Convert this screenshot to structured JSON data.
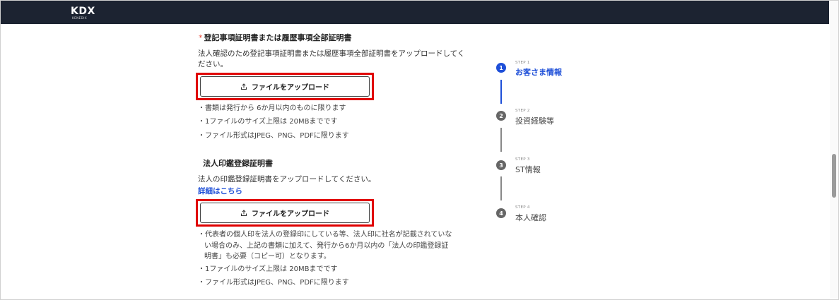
{
  "header": {
    "logo": "KDX",
    "logo_sub": "KENEDIX"
  },
  "section1": {
    "required_mark": "*",
    "title": "登記事項証明書または履歴事項全部証明書",
    "desc_line1": "法人確認のため登記事項証明書または履歴事項全部証明書をアップロードしてく",
    "desc_line2": "ださい。",
    "upload_label": "ファイルをアップロード",
    "bullets": [
      "・書類は発行から 6か月以内のものに限ります",
      "・1ファイルのサイズ上限は 20MBまでです",
      "・ファイル形式はJPEG、PNG、PDFに限ります"
    ]
  },
  "section2": {
    "title": "法人印鑑登録証明書",
    "desc": "法人の印鑑登録証明書をアップロードしてください。",
    "link": "詳細はこちら",
    "upload_label": "ファイルをアップロード",
    "note_lines": [
      "・代表者の個人印を法人の登録印にしている等、法人印に社名が記載されていな",
      "い場合のみ、上記の書類に加えて、発行から6か月以内の「法人の印鑑登録証",
      "明書」も必要（コピー可）となります。"
    ],
    "bullets": [
      "・1ファイルのサイズ上限は 20MBまでです",
      "・ファイル形式はJPEG、PNG、PDFに限ります"
    ]
  },
  "steps": [
    {
      "number": "1",
      "small": "STEP 1",
      "label": "お客さま情報",
      "active": true
    },
    {
      "number": "2",
      "small": "STEP 2",
      "label": "投資経験等",
      "active": false
    },
    {
      "number": "3",
      "small": "STEP 3",
      "label": "ST情報",
      "active": false
    },
    {
      "number": "4",
      "small": "STEP 4",
      "label": "本人確認",
      "active": false
    }
  ],
  "colors": {
    "header_bg": "#1c2331",
    "active_step": "#1e4fd8",
    "inactive_step": "#666666",
    "highlight_border": "#e00000",
    "required": "#e74c3c",
    "link": "#1e4fd8"
  },
  "icons": {
    "upload": "upload-icon"
  }
}
